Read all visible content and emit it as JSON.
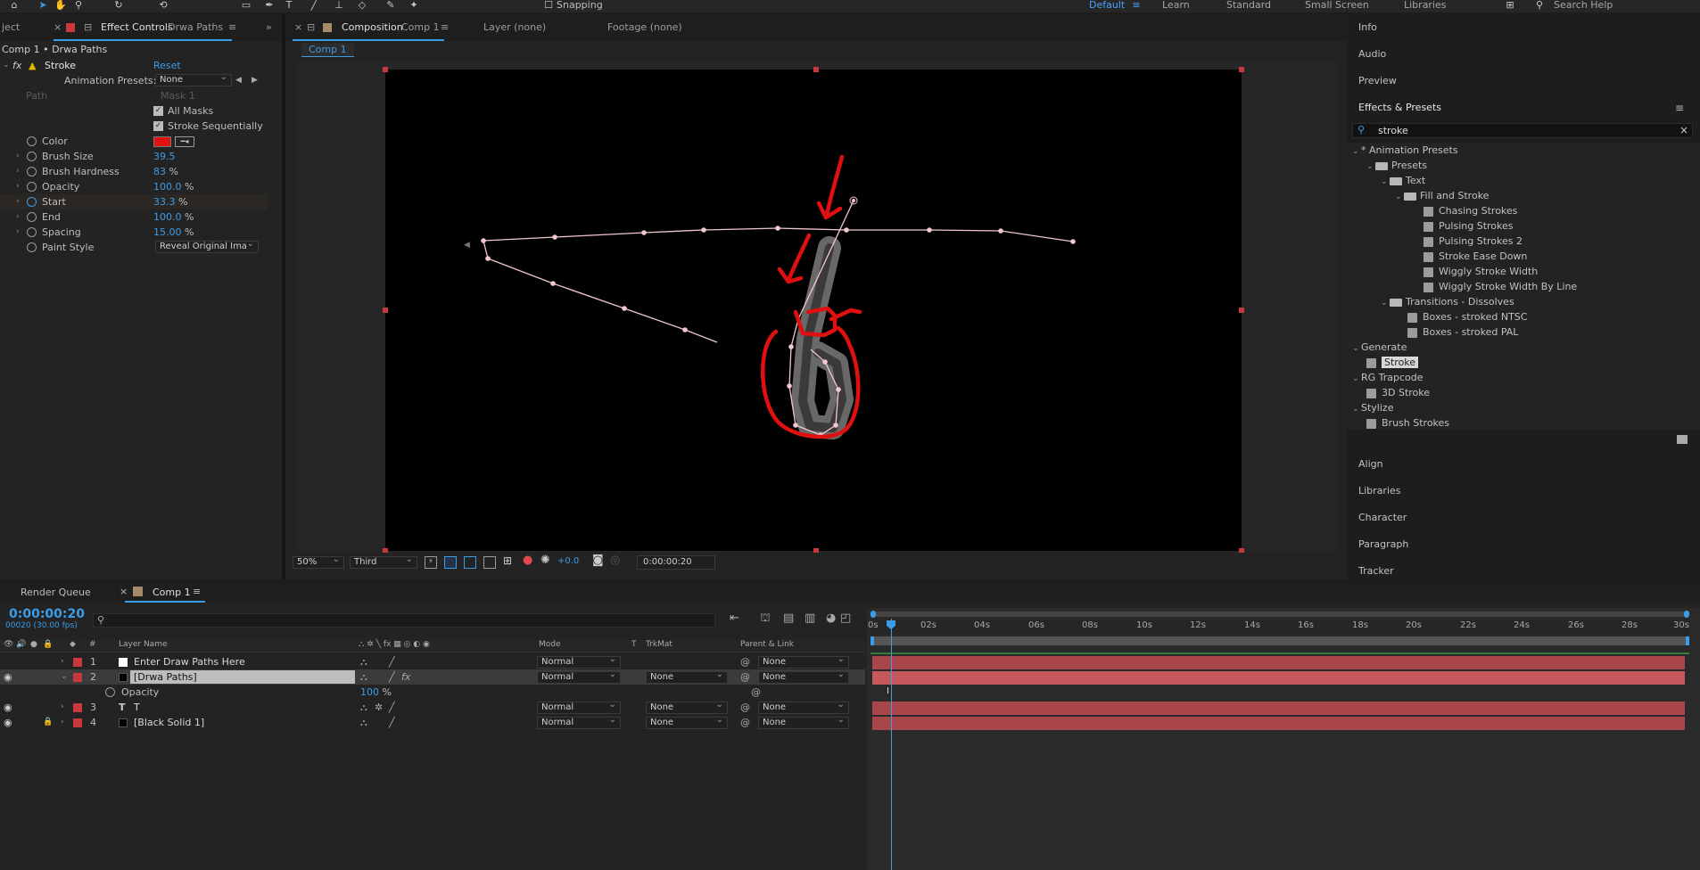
{
  "toolbar": {
    "snapping_label": "Snapping",
    "workspaces": [
      "Default",
      "Learn",
      "Standard",
      "Small Screen",
      "Libraries"
    ],
    "active_workspace": "Default",
    "search_placeholder": "Search Help"
  },
  "left_panel": {
    "project_tab": "ject",
    "effect_controls_tab": "Effect Controls",
    "effect_controls_layer": "Drwa Paths",
    "breadcrumb": "Comp 1 • Drwa Paths",
    "effect_name": "Stroke",
    "reset_label": "Reset",
    "animation_presets_label": "Animation Presets:",
    "animation_presets_value": "None",
    "path_label": "Path",
    "path_value": "Mask 1",
    "all_masks_label": "All Masks",
    "stroke_sequentially_label": "Stroke Sequentially",
    "params": [
      {
        "label": "Color",
        "value": ""
      },
      {
        "label": "Brush Size",
        "value": "39.5",
        "unit": ""
      },
      {
        "label": "Brush Hardness",
        "value": "83",
        "unit": "%"
      },
      {
        "label": "Opacity",
        "value": "100.0",
        "unit": "%"
      },
      {
        "label": "Start",
        "value": "33.3",
        "unit": "%"
      },
      {
        "label": "End",
        "value": "100.0",
        "unit": "%"
      },
      {
        "label": "Spacing",
        "value": "15.00",
        "unit": "%"
      },
      {
        "label": "Paint Style",
        "value": "Reveal Original Ima"
      }
    ],
    "stroke_color": "#e01313"
  },
  "composition": {
    "tab_label": "Composition",
    "comp_name": "Comp 1",
    "layer_tab": "Layer (none)",
    "footage_tab": "Footage (none)",
    "crumb": "Comp 1",
    "zoom": "50%",
    "resolution": "Third",
    "exposure": "+0.0",
    "timecode": "0:00:00:20"
  },
  "right_panel": {
    "info": "Info",
    "audio": "Audio",
    "preview": "Preview",
    "effects_presets_title": "Effects & Presets",
    "search_value": "stroke",
    "tree": [
      {
        "label": "* Animation Presets",
        "type": "cat"
      },
      {
        "label": "Presets",
        "type": "folder"
      },
      {
        "label": "Text",
        "type": "folder"
      },
      {
        "label": "Fill and Stroke",
        "type": "folder"
      },
      {
        "label": "Chasing Strokes",
        "type": "preset"
      },
      {
        "label": "Pulsing Strokes",
        "type": "preset"
      },
      {
        "label": "Pulsing Strokes 2",
        "type": "preset"
      },
      {
        "label": "Stroke Ease Down",
        "type": "preset"
      },
      {
        "label": "Wiggly Stroke Width",
        "type": "preset"
      },
      {
        "label": "Wiggly Stroke Width By Line",
        "type": "preset"
      },
      {
        "label": "Transitions - Dissolves",
        "type": "folder"
      },
      {
        "label": "Boxes - stroked NTSC",
        "type": "preset"
      },
      {
        "label": "Boxes - stroked PAL",
        "type": "preset"
      },
      {
        "label": "Generate",
        "type": "cat"
      },
      {
        "label": "Stroke",
        "type": "effect"
      },
      {
        "label": "RG Trapcode",
        "type": "cat"
      },
      {
        "label": "3D Stroke",
        "type": "effect"
      },
      {
        "label": "Stylize",
        "type": "cat"
      },
      {
        "label": "Brush Strokes",
        "type": "effect"
      }
    ],
    "align": "Align",
    "libraries": "Libraries",
    "character": "Character",
    "paragraph": "Paragraph",
    "tracker": "Tracker"
  },
  "timeline": {
    "render_queue_tab": "Render Queue",
    "comp_tab": "Comp 1",
    "current_time": "0:00:00:20",
    "frame_info": "00020 (30.00 fps)",
    "col_layer_name": "Layer Name",
    "col_mode": "Mode",
    "col_t": "T",
    "col_trkmat": "TrkMat",
    "col_parent": "Parent & Link",
    "layers": [
      {
        "num": "1",
        "name": "Enter Draw Paths Here",
        "mode": "Normal",
        "trkmat": "",
        "parent": "None",
        "color": "#ffffff"
      },
      {
        "num": "2",
        "name": "[Drwa Paths]",
        "mode": "Normal",
        "trkmat": "None",
        "parent": "None",
        "color": "#000000"
      },
      {
        "num": "3",
        "name": "T",
        "mode": "Normal",
        "trkmat": "None",
        "parent": "None",
        "color": ""
      },
      {
        "num": "4",
        "name": "[Black Solid 1]",
        "mode": "Normal",
        "trkmat": "None",
        "parent": "None",
        "color": "#000000"
      }
    ],
    "opacity_label": "Opacity",
    "opacity_value": "100",
    "opacity_unit": "%",
    "ruler": [
      "0s",
      "02s",
      "04s",
      "06s",
      "08s",
      "10s",
      "12s",
      "14s",
      "16s",
      "18s",
      "20s",
      "22s",
      "24s",
      "26s",
      "28s",
      "30s"
    ]
  },
  "colors": {
    "accent": "#3b9ce8",
    "label_red": "#c8383c",
    "bar_red": "#a9464b",
    "annotation_red": "#e01010",
    "path": "#f2c8cc"
  }
}
